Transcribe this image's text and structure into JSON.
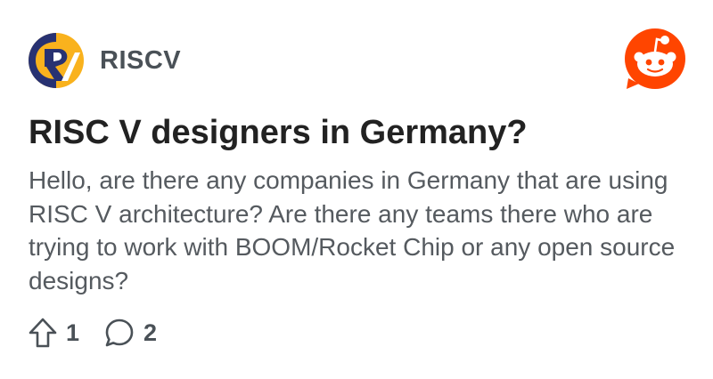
{
  "community": {
    "name": "RISCV",
    "logo_icon": "risc-v-logo",
    "logo_colors": [
      "#283272",
      "#f9b21d"
    ]
  },
  "brand": {
    "icon": "reddit-snoo-logo",
    "color": "#ff4500"
  },
  "post": {
    "title": "RISC V designers in Germany?",
    "body": "Hello, are there any companies in Germany that are using RISC V architecture? Are there any teams there who are trying to work with BOOM/Rocket Chip or any open source designs?"
  },
  "actions": {
    "upvote_icon": "upvote-arrow-icon",
    "upvote_count": "1",
    "comment_icon": "comment-bubble-icon",
    "comment_count": "2"
  }
}
